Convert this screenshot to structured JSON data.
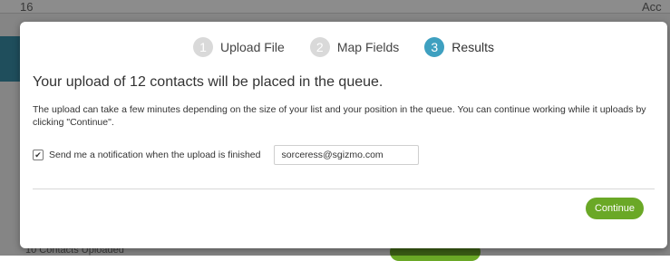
{
  "background": {
    "top_left_fragment": "16",
    "top_right_fragment": "Acc",
    "bottom_fragment": "10 Contacts Uploaded"
  },
  "steps": [
    {
      "num": "1",
      "label": "Upload File",
      "active": false
    },
    {
      "num": "2",
      "label": "Map Fields",
      "active": false
    },
    {
      "num": "3",
      "label": "Results",
      "active": true
    }
  ],
  "modal": {
    "headline": "Your upload of 12 contacts will be placed in the queue.",
    "description": "The upload can take a few minutes depending on the size of your list and your position in the queue. You can continue working while it uploads by clicking \"Continue\".",
    "notify_label": "Send me a notification when the upload is finished",
    "notify_checked": true,
    "email_value": "sorceress@sgizmo.com",
    "continue_label": "Continue"
  },
  "colors": {
    "accent": "#3ea0c0",
    "button": "#6aa826"
  }
}
